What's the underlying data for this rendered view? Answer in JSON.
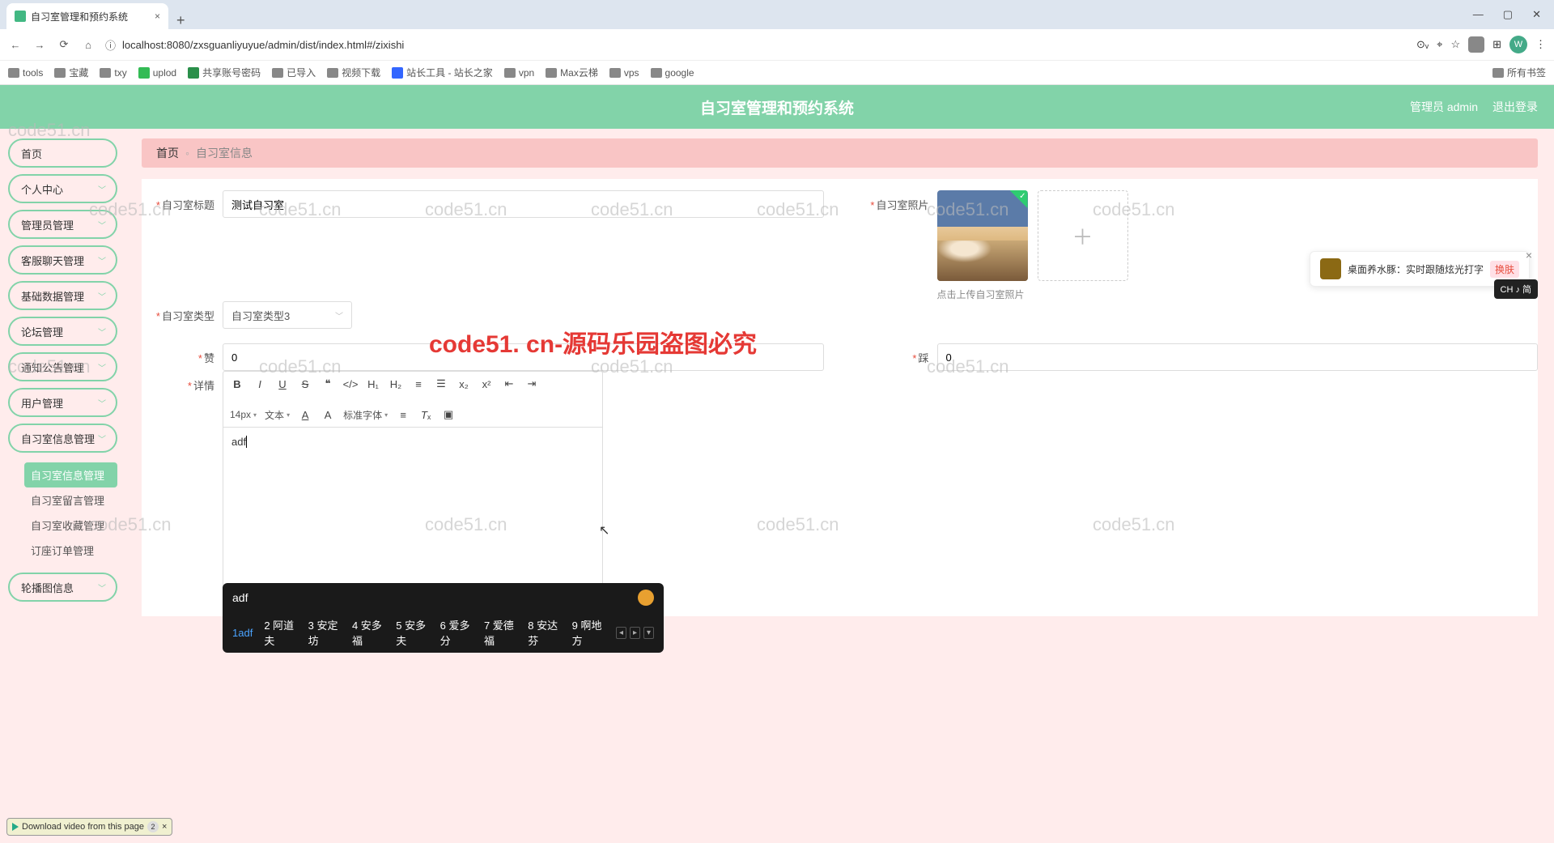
{
  "browser": {
    "tab_title": "自习室管理和预约系统",
    "url": "localhost:8080/zxsguanliyuyue/admin/dist/index.html#/zixishi",
    "bookmarks": [
      "tools",
      "宝藏",
      "txy",
      "uplod",
      "共享账号密码",
      "已导入",
      "视频下载",
      "站长工具 - 站长之家",
      "vpn",
      "Max云梯",
      "vps",
      "google"
    ],
    "bookmark_right": "所有书签",
    "avatar_letter": "W"
  },
  "header": {
    "title": "自习室管理和预约系统",
    "user": "管理员 admin",
    "logout": "退出登录"
  },
  "sidebar": {
    "items": [
      "首页",
      "个人中心",
      "管理员管理",
      "客服聊天管理",
      "基础数据管理",
      "论坛管理",
      "通知公告管理",
      "用户管理",
      "自习室信息管理"
    ],
    "sub_items": [
      "自习室信息管理",
      "自习室留言管理",
      "自习室收藏管理",
      "订座订单管理"
    ],
    "last_item": "轮播图信息"
  },
  "crumb": {
    "home": "首页",
    "current": "自习室信息"
  },
  "form": {
    "title_label": "自习室标题",
    "title_value": "测试自习室",
    "photo_label": "自习室照片",
    "photo_hint": "点击上传自习室照片",
    "type_label": "自习室类型",
    "type_value": "自习室类型3",
    "praise_label": "赞",
    "praise_value": "0",
    "dislike_label": "踩",
    "dislike_value": "0",
    "detail_label": "详情",
    "editor_content": "adf",
    "font_size": "14px",
    "font_format": "文本",
    "font_family": "标准字体"
  },
  "ime": {
    "input": "adf",
    "candidates": [
      "1adf",
      "2 阿道夫",
      "3 安定坊",
      "4 安多福",
      "5 安多夫",
      "6 爱多分",
      "7 爱德福",
      "8 安达芬",
      "9 啊地方"
    ],
    "badge": "CH ♪ 简"
  },
  "notify": {
    "text": "桌面养水豚：实时跟随炫光打字",
    "btn": "换肤"
  },
  "watermark_text": "code51.cn",
  "watermark_big": "code51. cn-源码乐园盗图必究",
  "download_bar": "Download video from this page",
  "plus": "＋"
}
